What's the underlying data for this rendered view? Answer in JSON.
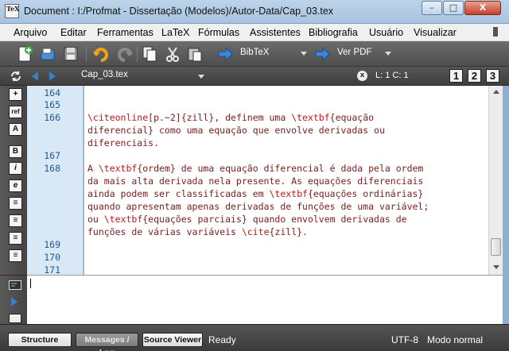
{
  "window": {
    "app_icon_text": "TeX",
    "title": "Document : I:/Profmat - Dissertação (Modelos)/Autor-Data/Cap_03.tex",
    "minimize_glyph": "–",
    "maximize_glyph": "□",
    "close_glyph": "X"
  },
  "menu": {
    "items": [
      "Arquivo",
      "Editar",
      "Ferramentas",
      "LaTeX",
      "Fórmulas",
      "Assistentes",
      "Bibliografia",
      "Usuário",
      "Visualizar"
    ]
  },
  "toolbar": {
    "icons": [
      "new-file-icon",
      "open-file-icon",
      "save-icon",
      "undo-icon",
      "redo-icon",
      "copy-icon",
      "cut-icon",
      "paste-icon"
    ],
    "quick_build": "BibTeX",
    "view_target": "Ver PDF"
  },
  "tabbar": {
    "file_name": "Cap_03.tex",
    "close_glyph": "x",
    "cursor_position": "L: 1 C: 1",
    "view_buttons": [
      "1",
      "2",
      "3"
    ]
  },
  "left_tools": {
    "buttons": [
      "+",
      "ref",
      "A",
      "B",
      "i",
      "e",
      "≡",
      "≡",
      "≡",
      "≡"
    ]
  },
  "editor": {
    "line_numbers": [
      {
        "label": "164"
      },
      {
        "label": "165"
      },
      {
        "label": "166"
      },
      {
        "label": "167"
      },
      {
        "label": "168"
      },
      {
        "label": "169"
      },
      {
        "label": "170"
      },
      {
        "label": "171"
      }
    ],
    "lines": [
      {
        "segments": [
          {
            "t": "\\citeonline",
            "k": "cmd"
          },
          {
            "t": "[p.~2]{zill}, definem uma ",
            "k": "arg"
          },
          {
            "t": "\\textbf",
            "k": "cmd"
          },
          {
            "t": "{equação",
            "k": "arg"
          }
        ]
      },
      {
        "segments": [
          {
            "t": "diferencial} como uma equação que envolve derivadas ou",
            "k": "arg"
          }
        ]
      },
      {
        "segments": [
          {
            "t": "diferenciais.",
            "k": "arg"
          }
        ]
      },
      {
        "segments": [
          {
            "t": "A ",
            "k": "arg"
          },
          {
            "t": "\\textbf",
            "k": "cmd"
          },
          {
            "t": "{ordem} de uma equação diferencial é dada pela ordem",
            "k": "arg"
          }
        ]
      },
      {
        "segments": [
          {
            "t": "da mais alta derivada nela presente. As equações diferenciais",
            "k": "arg"
          }
        ]
      },
      {
        "segments": [
          {
            "t": "ainda podem ser classificadas em ",
            "k": "arg"
          },
          {
            "t": "\\textbf",
            "k": "cmd"
          },
          {
            "t": "{equações ordinárias}",
            "k": "arg"
          }
        ]
      },
      {
        "segments": [
          {
            "t": "quando apresentam apenas derivadas de funções de uma variável;",
            "k": "arg"
          }
        ]
      },
      {
        "segments": [
          {
            "t": "ou ",
            "k": "arg"
          },
          {
            "t": "\\textbf",
            "k": "cmd"
          },
          {
            "t": "{equações parciais} quando envolvem derivadas de",
            "k": "arg"
          }
        ]
      },
      {
        "segments": [
          {
            "t": "funções de várias variáveis ",
            "k": "arg"
          },
          {
            "t": "\\cite",
            "k": "cmd"
          },
          {
            "t": "{zill}.",
            "k": "arg"
          }
        ]
      }
    ]
  },
  "statusbar": {
    "structure": "Structure",
    "messages": "Messages / Log",
    "source_viewer": "Source Viewer",
    "status": "Ready",
    "encoding": "UTF-8",
    "mode": "Modo normal"
  },
  "colors": {
    "command": "#c01818",
    "text": "#7a2020",
    "line_number": "#1d5a94",
    "gutter": "#d8e8f4"
  }
}
